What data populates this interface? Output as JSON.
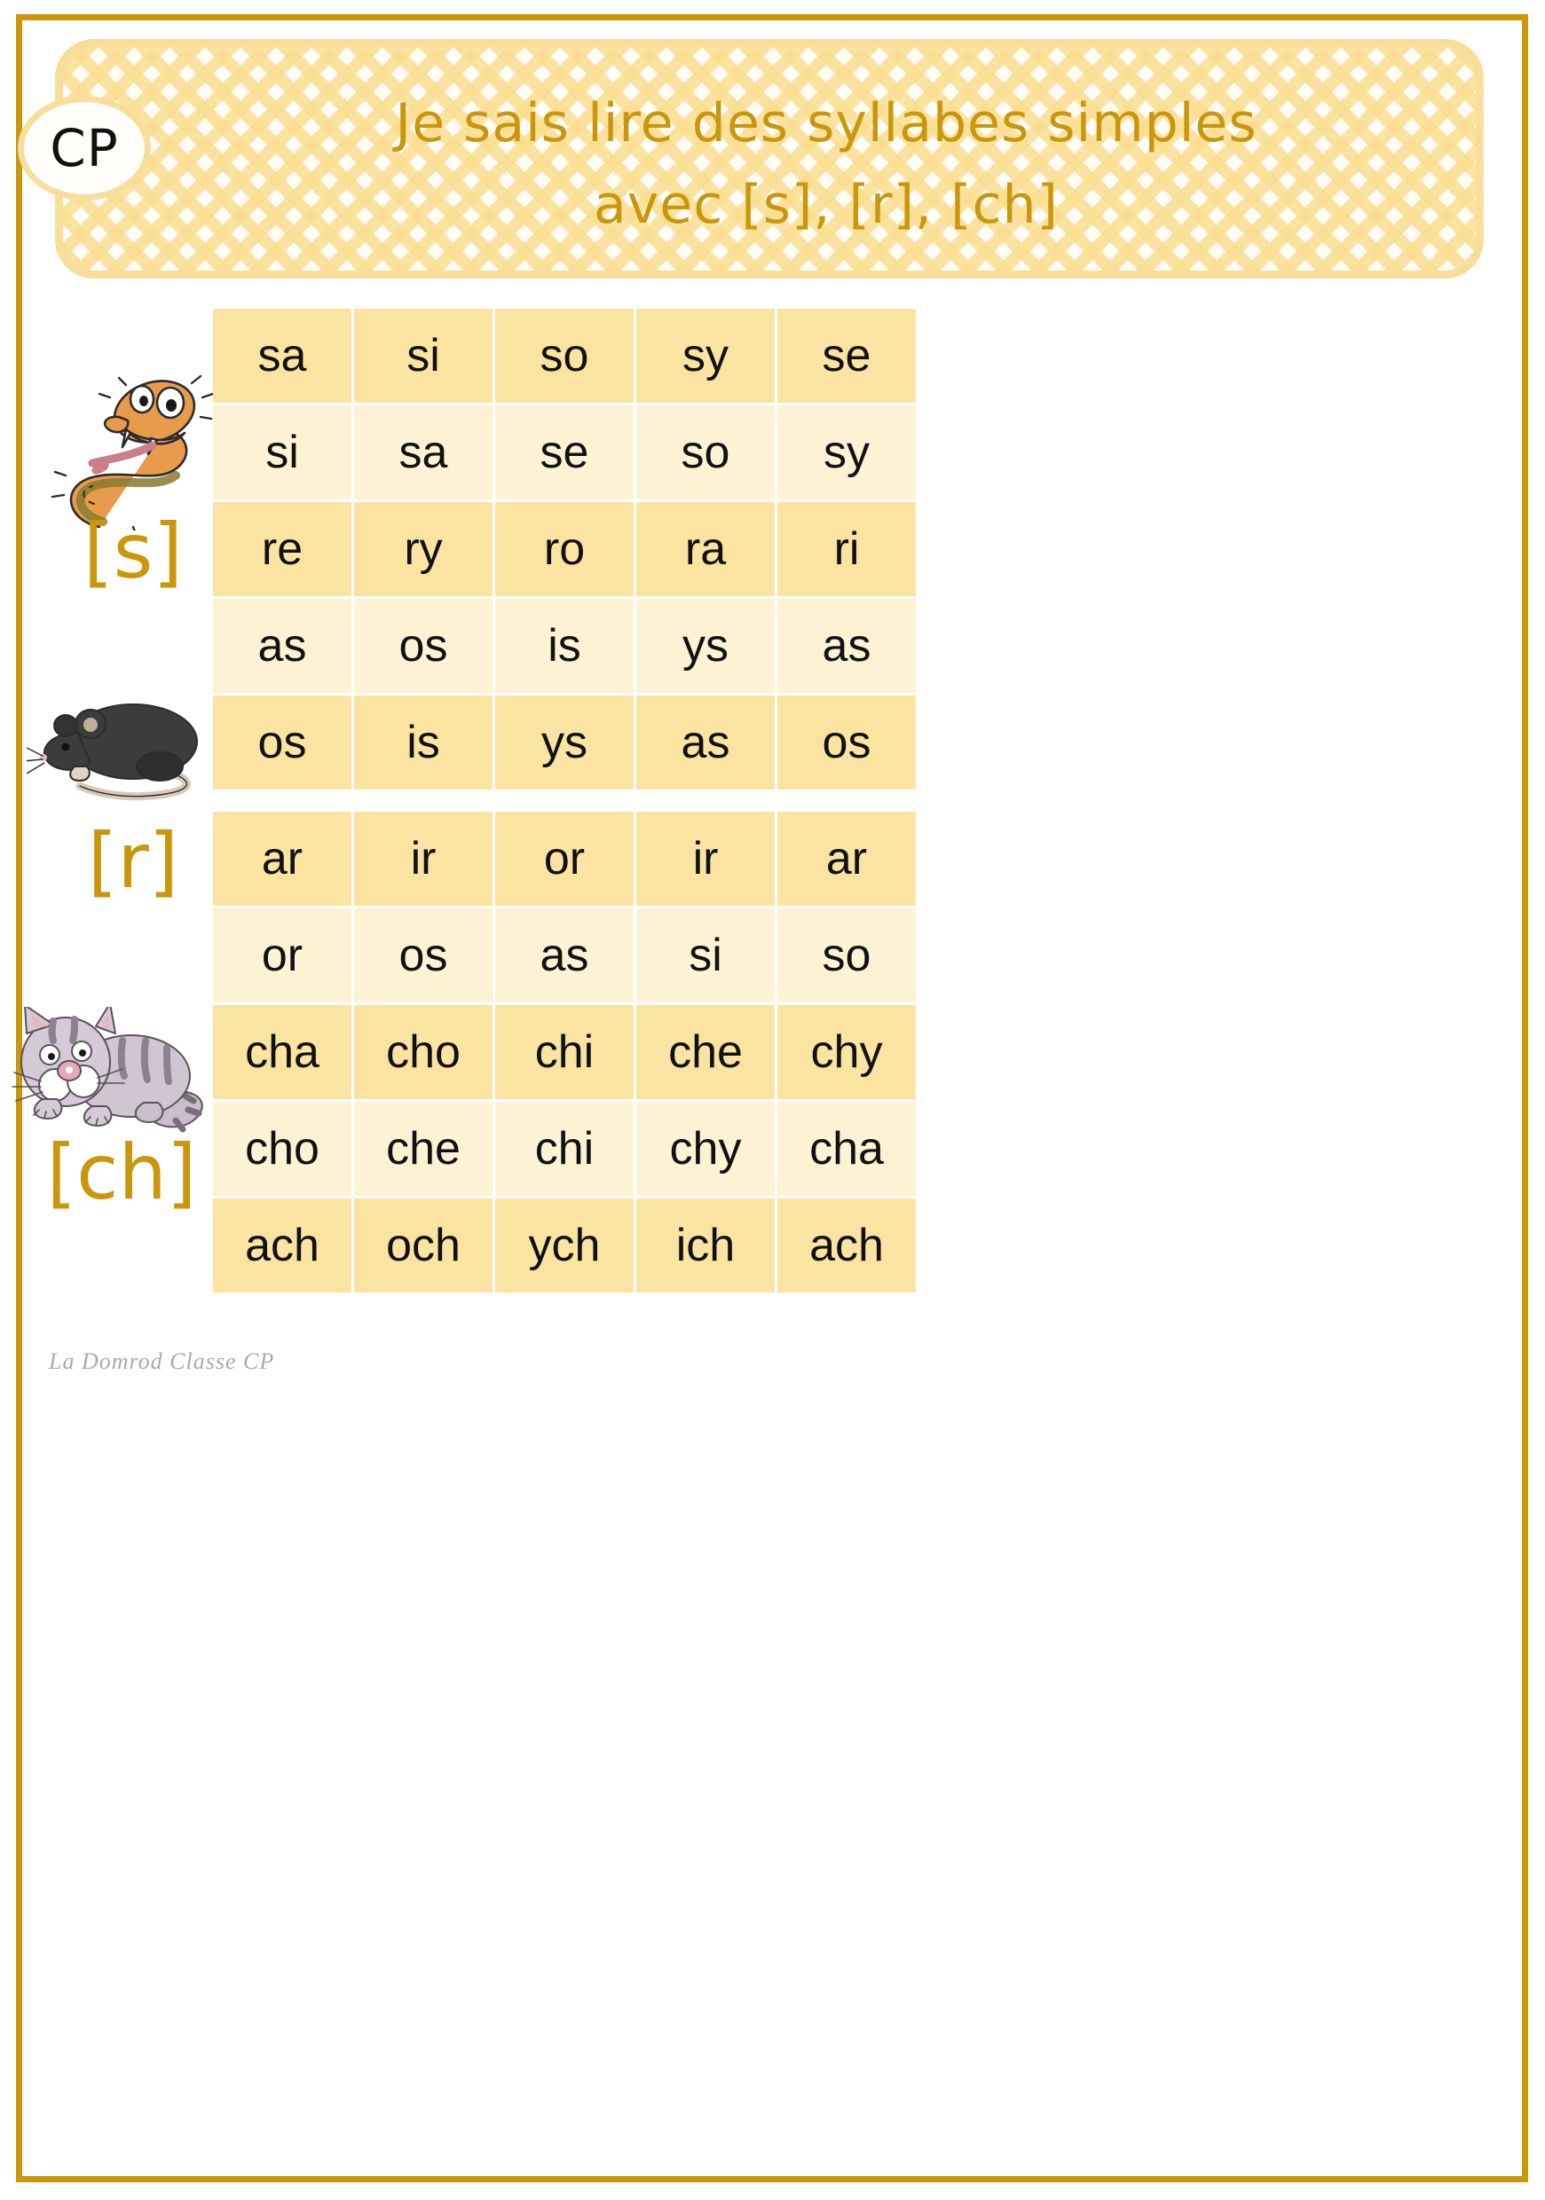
{
  "page": {
    "border_color": "#C9960C",
    "accent_color": "#C9960C",
    "cell_dark": "#FBE3A2",
    "cell_light": "#FDF3D4"
  },
  "header": {
    "badge_label": "CP",
    "title_line1": "Je sais lire des syllabes simples",
    "title_line2": "avec [s], [r], [ch]"
  },
  "phonemes": {
    "s": "[s]",
    "r": "[r]",
    "ch": "[ch]"
  },
  "illustrations": [
    {
      "name": "snake-illustration",
      "alt": "serpent"
    },
    {
      "name": "rat-illustration",
      "alt": "rat"
    },
    {
      "name": "cat-illustration",
      "alt": "chat"
    }
  ],
  "table": {
    "columns": 5,
    "groups": [
      {
        "id": "group-s-r",
        "rows": [
          {
            "shade": "dark",
            "cells": [
              "sa",
              "si",
              "so",
              "sy",
              "se"
            ]
          },
          {
            "shade": "light",
            "cells": [
              "si",
              "sa",
              "se",
              "so",
              "sy"
            ]
          },
          {
            "shade": "dark",
            "cells": [
              "re",
              "ry",
              "ro",
              "ra",
              "ri"
            ]
          },
          {
            "shade": "light",
            "cells": [
              "as",
              "os",
              "is",
              "ys",
              "as"
            ]
          },
          {
            "shade": "dark",
            "cells": [
              "os",
              "is",
              "ys",
              "as",
              "os"
            ]
          }
        ]
      },
      {
        "id": "group-r-ch",
        "rows": [
          {
            "shade": "dark",
            "cells": [
              "ar",
              "ir",
              "or",
              "ir",
              "ar"
            ]
          },
          {
            "shade": "light",
            "cells": [
              "or",
              "os",
              "as",
              "si",
              "so"
            ]
          },
          {
            "shade": "dark",
            "cells": [
              "cha",
              "cho",
              "chi",
              "che",
              "chy"
            ]
          },
          {
            "shade": "light",
            "cells": [
              "cho",
              "che",
              "chi",
              "chy",
              "cha"
            ]
          },
          {
            "shade": "dark",
            "cells": [
              "ach",
              "och",
              "ych",
              "ich",
              "ach"
            ]
          }
        ]
      }
    ]
  },
  "footer": {
    "signature": "La Domrod Classe CP"
  }
}
